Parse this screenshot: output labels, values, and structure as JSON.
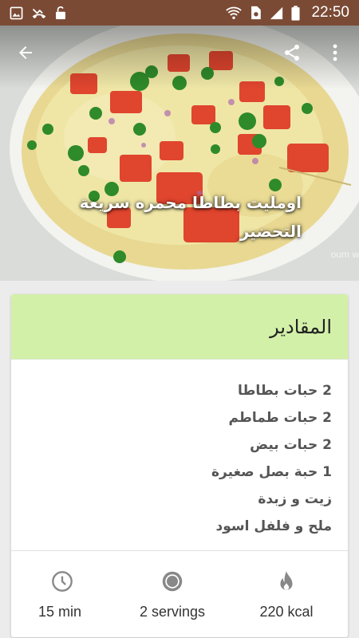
{
  "status_bar": {
    "time": "22:50",
    "icons": [
      "image-icon",
      "missed-call-icon",
      "unlock-icon",
      "wifi-icon",
      "sim-icon",
      "signal-icon",
      "battery-icon"
    ]
  },
  "app_bar": {
    "back_icon": "arrow-back-icon",
    "share_icon": "share-icon",
    "menu_icon": "more-vert-icon"
  },
  "recipe": {
    "title": "اومليت بطاطا محمره سريعة التحضير",
    "watermark": "oum w"
  },
  "ingredients_card": {
    "header": "المقادير",
    "header_color": "#d3f0a9",
    "items": [
      "2 حبات بطاطا",
      "2 حبات طماطم",
      "2 حبات بيض",
      "1 حبة بصل صغيرة",
      "زيت و زبدة",
      "ملح و فلفل اسود"
    ]
  },
  "stats": {
    "time": {
      "icon": "clock-icon",
      "label": "15 min"
    },
    "servings": {
      "icon": "servings-icon",
      "label": "2 servings"
    },
    "calories": {
      "icon": "flame-icon",
      "label": "220 kcal"
    }
  },
  "colors": {
    "status_bar": "#7a4a35",
    "page_bg": "#ececec"
  }
}
